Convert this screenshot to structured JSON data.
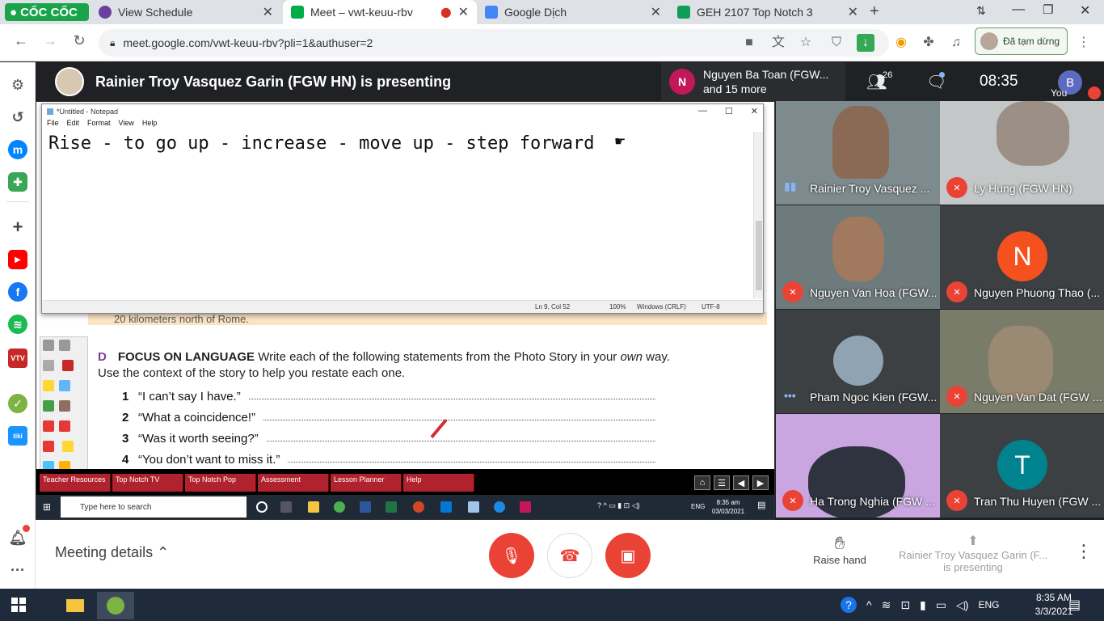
{
  "browser": {
    "logo_text": "CỐC CỐC",
    "tabs": [
      {
        "title": "View Schedule",
        "fav_color": "#6a3fa0"
      },
      {
        "title": "Meet – vwt-keuu-rbv",
        "fav_color": "#00ac47"
      },
      {
        "title": "Google Dịch",
        "fav_color": "#4285f4"
      },
      {
        "title": "GEH 2107 Top Notch 3",
        "fav_color": "#0f9d58"
      }
    ],
    "url": "meet.google.com/vwt-keuu-rbv?pli=1&authuser=2",
    "paused_label": "Đã tạm dừng"
  },
  "meet": {
    "presenting_title": "Rainier Troy Vasquez Garin (FGW HN) is presenting",
    "notify": {
      "initial": "N",
      "line1": "Nguyen Ba Toan (FGW...",
      "line2": "and 15 more"
    },
    "participant_count": "26",
    "time": "08:35",
    "you_label": "You",
    "you_initial": "B",
    "tiles": [
      {
        "name": "Rainier Troy Vasquez ...",
        "status": "talking"
      },
      {
        "name": "Ly Hung (FGW HN)",
        "status": "muted"
      },
      {
        "name": "Nguyen Van Hoa (FGW...",
        "status": "muted"
      },
      {
        "name": "Nguyen Phuong Thao (...",
        "status": "muted",
        "initial": "N",
        "color": "#f4511e"
      },
      {
        "name": "Pham Ngoc Kien (FGW...",
        "status": "dots"
      },
      {
        "name": "Nguyen Van Dat (FGW ...",
        "status": "muted"
      },
      {
        "name": "Ha Trong Nghia (FGW ...",
        "status": "muted"
      },
      {
        "name": "Tran Thu Huyen (FGW ...",
        "status": "muted",
        "initial": "T",
        "color": "#00838f"
      }
    ],
    "bottom": {
      "details_label": "Meeting details",
      "raise_hand": "Raise hand",
      "presenting_line1": "Rainier Troy Vasquez Garin (F...",
      "presenting_line2": "is presenting"
    }
  },
  "shared_screen": {
    "notepad": {
      "title": "*Untitled - Notepad",
      "menu": [
        "File",
        "Edit",
        "Format",
        "View",
        "Help"
      ],
      "text": "Rise - to go up - increase - move up - step forward",
      "status": {
        "pos": "Ln 9, Col 52",
        "zoom": "100%",
        "eol": "Windows (CRLF)",
        "enc": "UTF-8"
      }
    },
    "book": {
      "partial_line": "20 kilometers north of Rome.",
      "letter": "D",
      "heading": "FOCUS ON LANGUAGE",
      "instruction_a": "Write each of the following statements from the Photo Story in your",
      "instruction_em": "own",
      "instruction_b": "way. Use the context of the story to help you restate each one.",
      "questions": [
        {
          "num": "1",
          "text": "“I can’t say I have.”"
        },
        {
          "num": "2",
          "text": "“What a coincidence!”"
        },
        {
          "num": "3",
          "text": "“Was it worth seeing?”"
        },
        {
          "num": "4",
          "text": "“You don’t want to miss it.”"
        }
      ]
    },
    "topnotch_nav": [
      "Teacher Resources",
      "Top Notch TV",
      "Top Notch Pop",
      "Assessment",
      "Lesson Planner",
      "Help"
    ],
    "inner_taskbar": {
      "search_placeholder": "Type here to search",
      "lang": "ENG",
      "time": "8:35 am",
      "date": "03/03/2021"
    }
  },
  "taskbar": {
    "lang": "ENG",
    "time": "8:35 AM",
    "date": "3/3/2021"
  }
}
